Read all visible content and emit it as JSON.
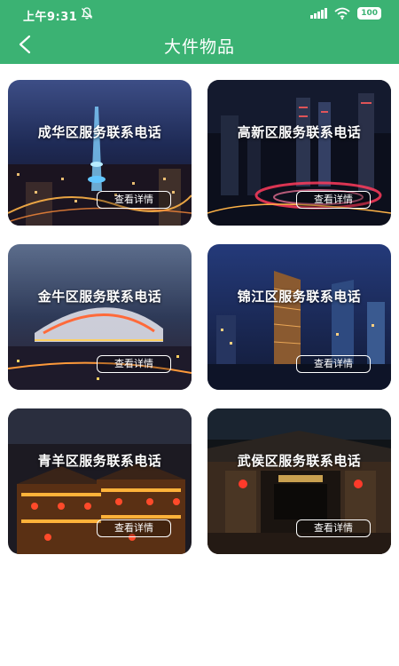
{
  "status_bar": {
    "time": "上午9:31",
    "battery": "100",
    "icons": [
      "bell-off-icon",
      "signal-icon",
      "wifi-icon",
      "battery-icon"
    ]
  },
  "header": {
    "title": "大件物品",
    "back_icon": "chevron-left-icon",
    "background_color": "#3bb273"
  },
  "cards": [
    {
      "title": "成华区服务联系电话",
      "button": "查看详情"
    },
    {
      "title": "高新区服务联系电话",
      "button": "查看详情"
    },
    {
      "title": "金牛区服务联系电话",
      "button": "查看详情"
    },
    {
      "title": "锦江区服务联系电话",
      "button": "查看详情"
    },
    {
      "title": "青羊区服务联系电话",
      "button": "查看详情"
    },
    {
      "title": "武侯区服务联系电话",
      "button": "查看详情"
    }
  ]
}
